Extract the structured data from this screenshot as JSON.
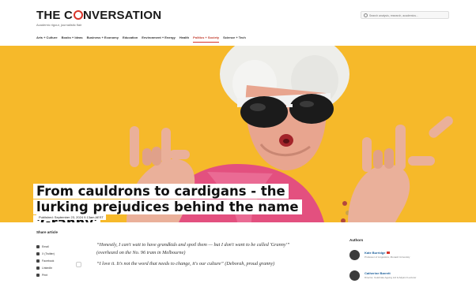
{
  "header": {
    "logo_text_1": "THE C",
    "logo_text_2": "NVERSATION",
    "tagline": "Academic rigour, journalistic flair",
    "search_placeholder": "Search analysis, research, academics..."
  },
  "nav": {
    "items": [
      {
        "label": "Arts + Culture"
      },
      {
        "label": "Books + Ideas"
      },
      {
        "label": "Business + Economy"
      },
      {
        "label": "Education"
      },
      {
        "label": "Environment + Energy"
      },
      {
        "label": "Health"
      },
      {
        "label": "Politics + Society"
      },
      {
        "label": "Science + Tech"
      }
    ],
    "active": "Politics + Society"
  },
  "hero": {
    "background_color": "#f6b92a"
  },
  "article": {
    "headline": "From cauldrons to cardigans - the lurking prejudices behind the name 'Granny'",
    "published": "Published: September 23, 2024 9.13am AEST",
    "paragraphs": [
      "“Honestly, I can't wait to have grandkids and spoil them — but I don't want to be called 'Granny'” (overheard on the No. 96 tram in Melbourne)",
      "“I love it. It's not the word that needs to change, it's our culture” (Deborah, proud granny)"
    ]
  },
  "share": {
    "title": "Share article",
    "items": [
      {
        "label": "Email",
        "icon": "email-icon"
      },
      {
        "label": "X (Twitter)",
        "icon": "x-icon"
      },
      {
        "label": "Facebook",
        "icon": "facebook-icon"
      },
      {
        "label": "LinkedIn",
        "icon": "linkedin-icon"
      },
      {
        "label": "Print",
        "icon": "print-icon"
      }
    ]
  },
  "authors": {
    "title": "Authors",
    "list": [
      {
        "name": "Kate Burridge",
        "role": "Professor of Linguistics, Monash University"
      },
      {
        "name": "Catherine Barrett",
        "role": "Director, Celebrate Ageing Ltd & Adjunct Lecturer"
      }
    ]
  }
}
